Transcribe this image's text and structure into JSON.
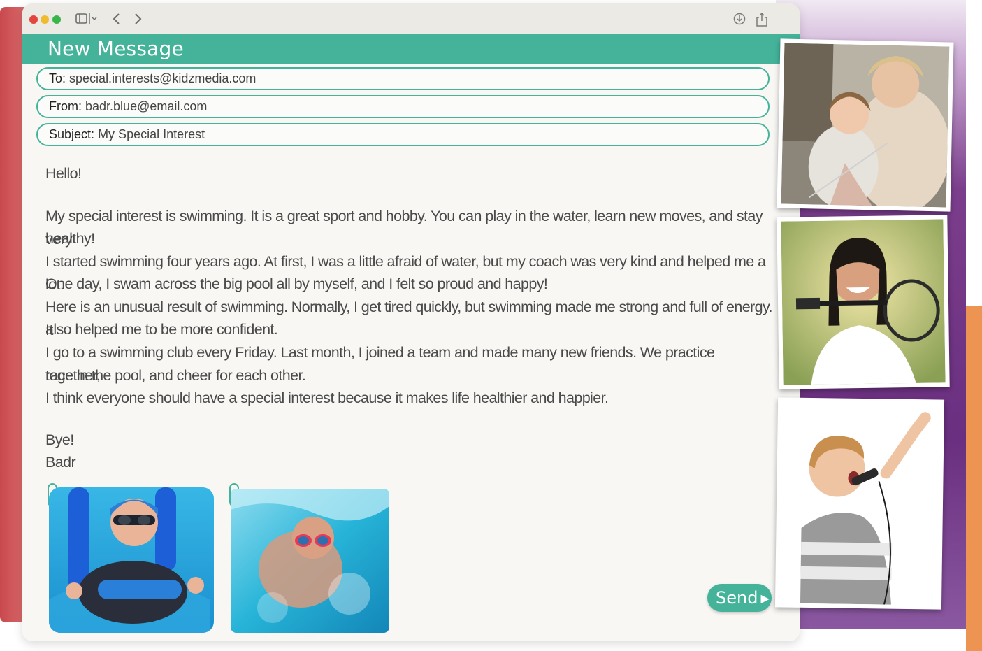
{
  "window": {
    "title": "New Message"
  },
  "email": {
    "to_label": "To:",
    "to_value": "special.interests@kidzmedia.com",
    "from_label": "From:",
    "from_value": "badr.blue@email.com",
    "subject_label": "Subject:",
    "subject_value": "My Special Interest"
  },
  "body": {
    "greeting": "Hello!",
    "p1_line1": "My special interest is swimming. It is a great sport and hobby. You can play in the water, learn new moves, and stay very",
    "p1_line2": "healthy!",
    "p2_line1": "I started swimming four years ago. At first, I was a little afraid of water, but my coach was very kind and helped me a lot.",
    "p2_line2": "One day, I swam across the big pool all by myself, and I felt so proud and happy!",
    "p3_line1": "Here is an unusual result of swimming. Normally, I get tired quickly, but swimming made me strong and full of energy. It",
    "p3_line2": "also helped me to be more confident.",
    "p4_line1": "I go to a swimming club every Friday. Last month, I joined a team and made many new friends. We practice together,",
    "p4_line2": "race in the pool, and cheer for each other.",
    "p5_line1": "I think everyone should have a special interest because it makes life healthier and happier.",
    "signoff": "Bye!",
    "name": "Badr"
  },
  "buttons": {
    "send_label": "Send"
  },
  "icons": {
    "sidebar": "sidebar-icon",
    "back": "chevron-left-icon",
    "forward": "chevron-right-icon",
    "download": "download-icon",
    "share": "share-icon",
    "send_arrow": "play-arrow-icon"
  },
  "colors": {
    "accent": "#44b39a",
    "purple": "#6a2f80",
    "orange": "#ee9453",
    "red": "#c8494d"
  }
}
